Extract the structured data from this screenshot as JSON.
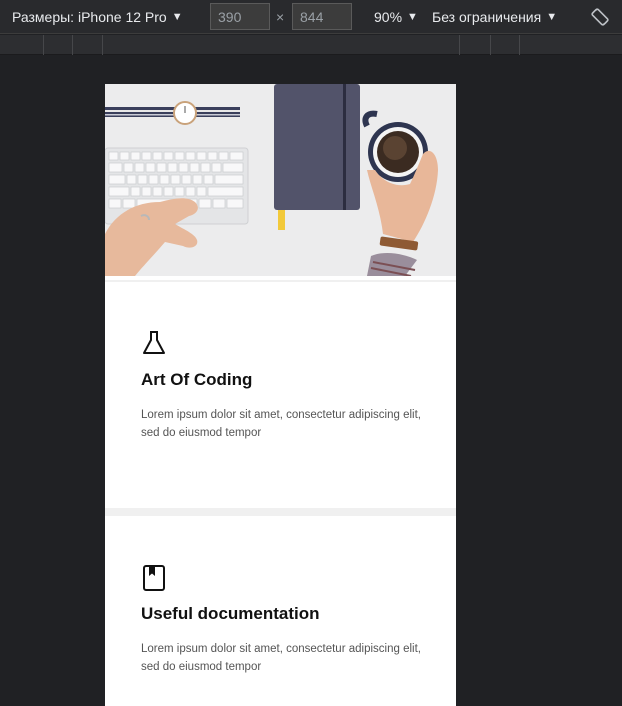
{
  "toolbar": {
    "device_label": "Размеры: iPhone 12 Pro",
    "width_value": "390",
    "height_value": "844",
    "times_symbol": "×",
    "zoom_label": "90%",
    "throttle_label": "Без ограничения",
    "caret": "▼",
    "rotate_icon": "rotate-icon"
  },
  "cards": [
    {
      "icon": "flask-icon",
      "title": "Art Of Coding",
      "text": "Lorem ipsum dolor sit amet, consectetur adipiscing elit, sed do eiusmod tempor"
    },
    {
      "icon": "book-icon",
      "title": "Useful documentation",
      "text": "Lorem ipsum dolor sit amet, consectetur adipiscing elit, sed do eiusmod tempor"
    }
  ]
}
